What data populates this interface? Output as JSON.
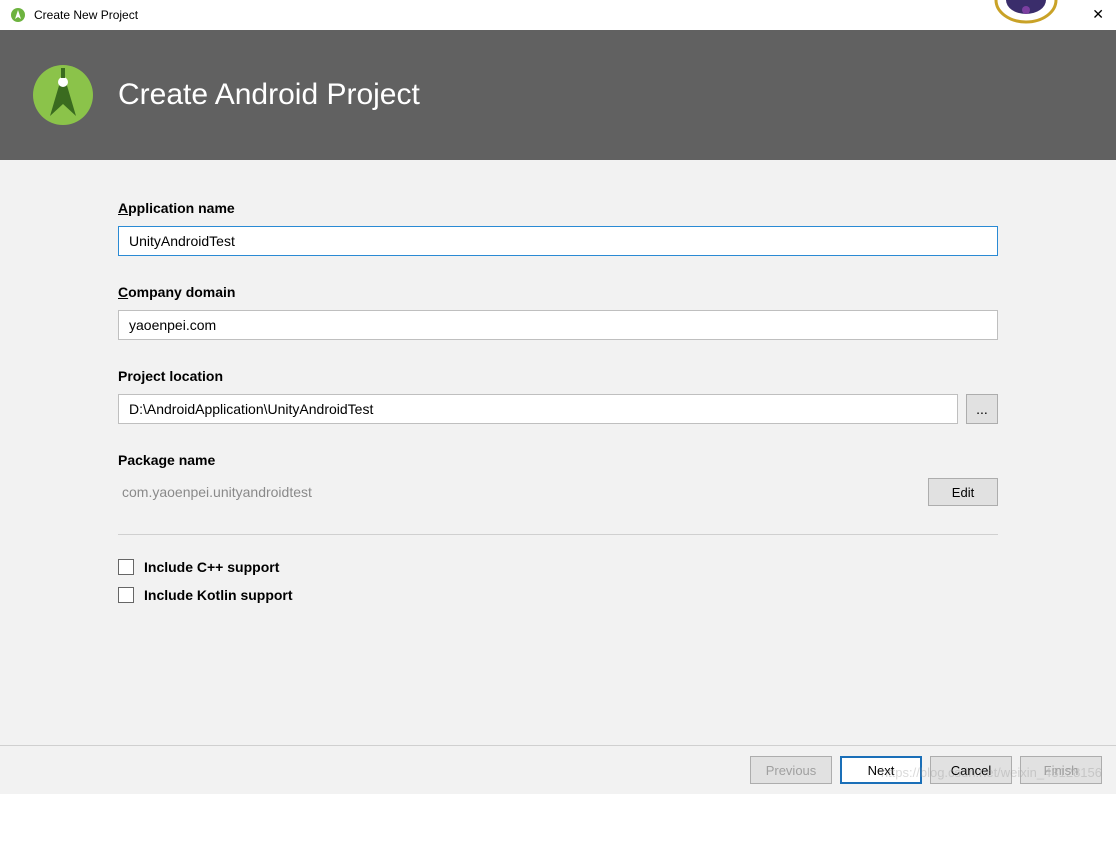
{
  "window": {
    "title": "Create New Project"
  },
  "header": {
    "title": "Create Android Project"
  },
  "form": {
    "appName": {
      "label_pre": "A",
      "label_rest": "pplication name",
      "value": "UnityAndroidTest"
    },
    "companyDomain": {
      "label_pre": "C",
      "label_rest": "ompany domain",
      "value": "yaoenpei.com"
    },
    "projectLocation": {
      "label": "Project location",
      "value": "D:\\AndroidApplication\\UnityAndroidTest",
      "browse": "..."
    },
    "packageName": {
      "label": "Package name",
      "value": "com.yaoenpei.unityandroidtest",
      "editButton": "Edit"
    },
    "includeCpp": "Include C++ support",
    "includeKotlin": "Include Kotlin support"
  },
  "footer": {
    "previous": "Previous",
    "next": "Next",
    "cancel": "Cancel",
    "finish": "Finish"
  },
  "watermark": "https://blog.csdn.net/weixin_43128156"
}
